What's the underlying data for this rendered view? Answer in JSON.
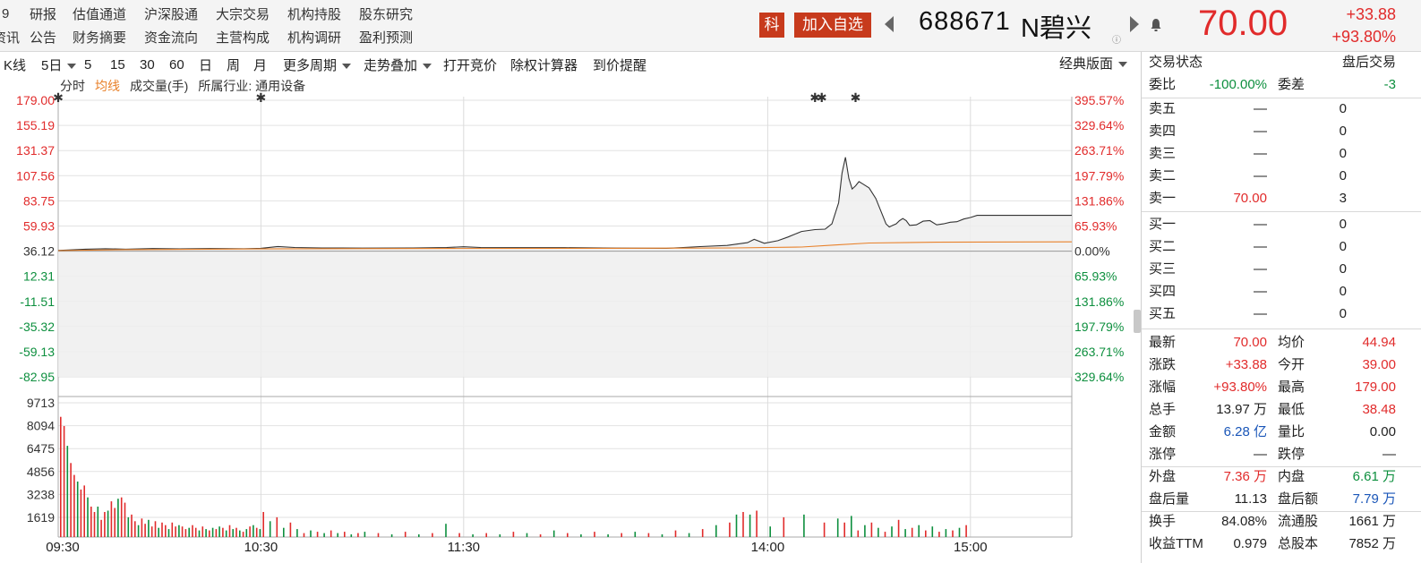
{
  "header": {
    "nav_row1": [
      "9",
      "研报",
      "估值通道",
      "沪深股通",
      "大宗交易",
      "机构持股",
      "股东研究"
    ],
    "nav_row2": [
      "资讯",
      "公告",
      "财务摘要",
      "资金流向",
      "主营构成",
      "机构调研",
      "盈利预测"
    ],
    "board_badge": "科",
    "add_watchlist": "加入自选",
    "stock_code": "688671",
    "stock_name": "N碧兴",
    "info_mark": "ⓘ",
    "last_price": "70.00",
    "change_amount": "+33.88",
    "change_percent": "+93.80%"
  },
  "toolbar": {
    "items": [
      "K线",
      "5日",
      "5",
      "15",
      "30",
      "60",
      "日",
      "周",
      "月",
      "更多周期",
      "走势叠加",
      "打开竞价",
      "除权计算器",
      "到价提醒"
    ],
    "layout_label": "经典版面"
  },
  "legend": {
    "items": [
      "分时",
      "均线",
      "成交量(手)",
      "所属行业: 通用设备"
    ]
  },
  "chart_data": {
    "type": "line",
    "title": "",
    "time_axis": [
      "09:30",
      "10:30",
      "11:30",
      "14:00",
      "15:00"
    ],
    "price_ticks": [
      "179.00",
      "155.19",
      "131.37",
      "107.56",
      "83.75",
      "59.93",
      "36.12",
      "12.31",
      "-11.51",
      "-35.32",
      "-59.13",
      "-82.95"
    ],
    "percent_ticks": [
      "395.57%",
      "329.64%",
      "263.71%",
      "197.79%",
      "131.86%",
      "65.93%",
      "0.00%",
      "65.93%",
      "131.86%",
      "197.79%",
      "263.71%",
      "329.64%"
    ],
    "volume_ticks": [
      "9713",
      "8094",
      "6475",
      "4856",
      "3238",
      "1619"
    ],
    "price_range": [
      -82.95,
      179.0
    ],
    "prev_close": 36.12,
    "volume_max": 9713,
    "series": [
      {
        "name": "分时",
        "color": "#333333",
        "points": [
          [
            0,
            36.8
          ],
          [
            3,
            37.2
          ],
          [
            8,
            38.0
          ],
          [
            14,
            38.4
          ],
          [
            20,
            38.0
          ],
          [
            28,
            38.6
          ],
          [
            36,
            38.2
          ],
          [
            45,
            38.6
          ],
          [
            55,
            38.4
          ],
          [
            60,
            38.8
          ],
          [
            65,
            40.5
          ],
          [
            70,
            39.6
          ],
          [
            78,
            39.2
          ],
          [
            90,
            39.0
          ],
          [
            105,
            39.2
          ],
          [
            115,
            39.6
          ],
          [
            120,
            40.3
          ],
          [
            125,
            39.6
          ],
          [
            135,
            39.4
          ],
          [
            150,
            39.4
          ],
          [
            165,
            39.0
          ],
          [
            180,
            38.8
          ],
          [
            185,
            39.6
          ],
          [
            190,
            40.4
          ],
          [
            198,
            41.5
          ],
          [
            204,
            44.2
          ],
          [
            206,
            47.3
          ],
          [
            209,
            43.6
          ],
          [
            213,
            46.0
          ],
          [
            216,
            49.5
          ],
          [
            220,
            54.8
          ],
          [
            224,
            56.5
          ],
          [
            227,
            57.0
          ],
          [
            229,
            62.0
          ],
          [
            231,
            82.0
          ],
          [
            232,
            110.0
          ],
          [
            233,
            125.0
          ],
          [
            234,
            105.0
          ],
          [
            235,
            95.0
          ],
          [
            236,
            98.0
          ],
          [
            237,
            102.0
          ],
          [
            238,
            100.0
          ],
          [
            240,
            96.0
          ],
          [
            242,
            86.0
          ],
          [
            244,
            70.0
          ],
          [
            245,
            62.0
          ],
          [
            246,
            59.0
          ],
          [
            247,
            60.5
          ],
          [
            248,
            62.0
          ],
          [
            249,
            65.0
          ],
          [
            250,
            67.0
          ],
          [
            251,
            65.0
          ],
          [
            252,
            60.5
          ],
          [
            254,
            61.0
          ],
          [
            256,
            64.5
          ],
          [
            258,
            65.0
          ],
          [
            260,
            61.0
          ],
          [
            262,
            62.0
          ],
          [
            264,
            63.5
          ],
          [
            266,
            64.0
          ],
          [
            268,
            66.5
          ],
          [
            270,
            68.0
          ],
          [
            272,
            70.0
          ],
          [
            290,
            70.0
          ],
          [
            300,
            70.0
          ]
        ]
      },
      {
        "name": "均线",
        "color": "#e8812a",
        "points": [
          [
            0,
            36.6
          ],
          [
            20,
            37.6
          ],
          [
            60,
            38.2
          ],
          [
            100,
            38.6
          ],
          [
            160,
            38.8
          ],
          [
            200,
            39.2
          ],
          [
            220,
            40.0
          ],
          [
            230,
            42.0
          ],
          [
            240,
            43.8
          ],
          [
            260,
            44.6
          ],
          [
            300,
            44.94
          ]
        ]
      }
    ],
    "volume": {
      "x": [
        0,
        1,
        2,
        3,
        4,
        5,
        6,
        7,
        8,
        9,
        10,
        11,
        12,
        13,
        14,
        15,
        16,
        17,
        18,
        19,
        20,
        21,
        22,
        23,
        24,
        25,
        26,
        27,
        28,
        29,
        30,
        31,
        32,
        33,
        34,
        35,
        36,
        37,
        38,
        39,
        40,
        41,
        42,
        43,
        44,
        45,
        46,
        47,
        48,
        49,
        50,
        51,
        52,
        53,
        54,
        55,
        56,
        57,
        58,
        59,
        60,
        62,
        64,
        66,
        68,
        70,
        72,
        74,
        76,
        78,
        80,
        82,
        84,
        86,
        88,
        90,
        94,
        98,
        102,
        106,
        110,
        114,
        118,
        122,
        126,
        130,
        134,
        138,
        142,
        146,
        150,
        154,
        158,
        162,
        166,
        170,
        174,
        178,
        182,
        186,
        190,
        194,
        198,
        200,
        202,
        204,
        206,
        210,
        214,
        220,
        226,
        230,
        232,
        234,
        236,
        238,
        240,
        242,
        244,
        246,
        248,
        250,
        252,
        254,
        256,
        258,
        260,
        262,
        264,
        266,
        268,
        270
      ],
      "values": [
        9100,
        8400,
        6900,
        5600,
        4700,
        4200,
        3600,
        3900,
        3000,
        2300,
        1900,
        2300,
        1300,
        1900,
        2000,
        2700,
        2200,
        2900,
        3000,
        2600,
        1500,
        1700,
        1200,
        900,
        1400,
        1000,
        1300,
        800,
        1200,
        700,
        1100,
        900,
        600,
        1100,
        800,
        900,
        800,
        600,
        700,
        900,
        700,
        500,
        800,
        600,
        500,
        700,
        600,
        800,
        700,
        500,
        900,
        600,
        700,
        500,
        400,
        600,
        800,
        900,
        700,
        600,
        1900,
        1200,
        1500,
        700,
        1100,
        600,
        300,
        500,
        400,
        300,
        500,
        300,
        400,
        200,
        300,
        400,
        300,
        200,
        400,
        200,
        300,
        1000,
        300,
        200,
        300,
        200,
        400,
        300,
        200,
        500,
        300,
        200,
        400,
        200,
        300,
        400,
        300,
        200,
        500,
        300,
        600,
        900,
        1100,
        1700,
        1900,
        1700,
        2000,
        800,
        1500,
        1700,
        1100,
        1400,
        1100,
        1600,
        500,
        900,
        1100,
        700,
        400,
        800,
        1300,
        600,
        700,
        900,
        500,
        800,
        400,
        600,
        500,
        700,
        900
      ],
      "colors": "first bars red (rising), later mix of red and green"
    }
  },
  "right_panel": {
    "trade_status_label": "交易状态",
    "trade_status_value": "盘后交易",
    "weibi_label": "委比",
    "weibi_value": "-100.00%",
    "weicha_label": "委差",
    "weicha_value": "-3",
    "asks": [
      {
        "label": "卖五",
        "price": "—",
        "vol": "0"
      },
      {
        "label": "卖四",
        "price": "—",
        "vol": "0"
      },
      {
        "label": "卖三",
        "price": "—",
        "vol": "0"
      },
      {
        "label": "卖二",
        "price": "—",
        "vol": "0"
      },
      {
        "label": "卖一",
        "price": "70.00",
        "vol": "3"
      }
    ],
    "bids": [
      {
        "label": "买一",
        "price": "—",
        "vol": "0"
      },
      {
        "label": "买二",
        "price": "—",
        "vol": "0"
      },
      {
        "label": "买三",
        "price": "—",
        "vol": "0"
      },
      {
        "label": "买四",
        "price": "—",
        "vol": "0"
      },
      {
        "label": "买五",
        "price": "—",
        "vol": "0"
      }
    ],
    "stats": [
      {
        "l1": "最新",
        "v1": "70.00",
        "c1": "red",
        "l2": "均价",
        "v2": "44.94",
        "c2": "red"
      },
      {
        "l1": "涨跌",
        "v1": "+33.88",
        "c1": "red",
        "l2": "今开",
        "v2": "39.00",
        "c2": "red"
      },
      {
        "l1": "涨幅",
        "v1": "+93.80%",
        "c1": "red",
        "l2": "最高",
        "v2": "179.00",
        "c2": "red"
      },
      {
        "l1": "总手",
        "v1": "13.97 万",
        "c1": "dark",
        "l2": "最低",
        "v2": "38.48",
        "c2": "red"
      },
      {
        "l1": "金额",
        "v1": "6.28 亿",
        "c1": "blue",
        "l2": "量比",
        "v2": "0.00",
        "c2": "dark"
      },
      {
        "l1": "涨停",
        "v1": "—",
        "c1": "dark",
        "l2": "跌停",
        "v2": "—",
        "c2": "dark"
      },
      {
        "l1": "外盘",
        "v1": "7.36 万",
        "c1": "red",
        "l2": "内盘",
        "v2": "6.61 万",
        "c2": "green"
      },
      {
        "l1": "盘后量",
        "v1": "11.13",
        "c1": "dark",
        "l2": "盘后额",
        "v2": "7.79 万",
        "c2": "blue"
      },
      {
        "l1": "换手",
        "v1": "84.08%",
        "c1": "dark",
        "l2": "流通股",
        "v2": "1661 万",
        "c2": "dark"
      },
      {
        "l1": "收益TTM",
        "v1": "0.979",
        "c1": "dark",
        "l2": "总股本",
        "v2": "7852 万",
        "c2": "dark"
      }
    ]
  },
  "colors": {
    "up": "#e12b2b",
    "down": "#0d8f3e",
    "accent": "#c73a1c",
    "avg_line": "#e8812a"
  }
}
